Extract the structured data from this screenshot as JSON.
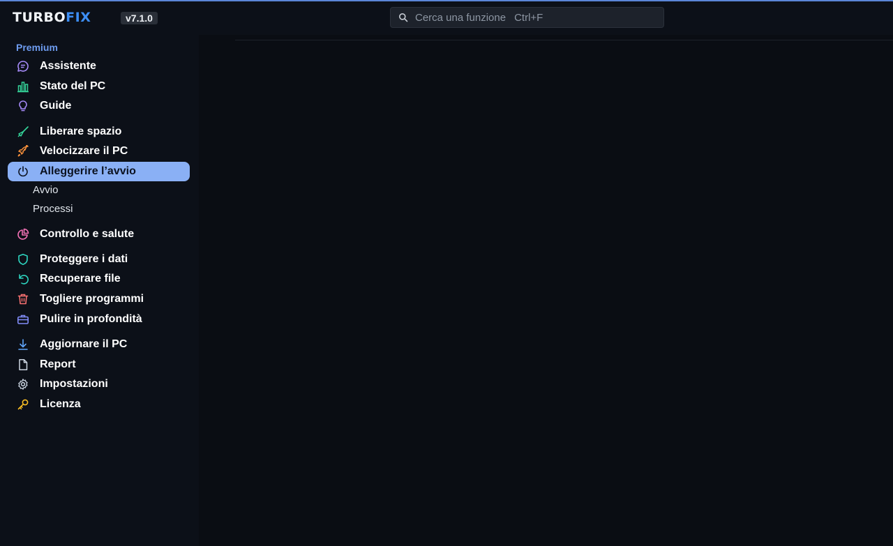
{
  "app": {
    "logo_part1": "TURBO",
    "logo_part2": "FIX",
    "version": "v7.1.0"
  },
  "search": {
    "placeholder": "Cerca una funzione",
    "shortcut": "Ctrl+F"
  },
  "sidebar": {
    "section_label": "Premium",
    "items": [
      {
        "label": "Assistente",
        "icon": "chat-icon",
        "color": "#a78bfa"
      },
      {
        "label": "Stato del PC",
        "icon": "bar-chart-icon",
        "color": "#34d399"
      },
      {
        "label": "Guide",
        "icon": "lightbulb-icon",
        "color": "#a78bfa"
      },
      {
        "label": "Liberare spazio",
        "icon": "broom-icon",
        "color": "#34d399"
      },
      {
        "label": "Velocizzare il PC",
        "icon": "rocket-icon",
        "color": "#fb923c"
      },
      {
        "label": "Alleggerire l’avvio",
        "icon": "power-icon",
        "color": "#0b1220",
        "active": true
      },
      {
        "label": "Controllo e salute",
        "icon": "pie-chart-icon",
        "color": "#f472b6"
      },
      {
        "label": "Proteggere i dati",
        "icon": "shield-icon",
        "color": "#2dd4bf"
      },
      {
        "label": "Recuperare file",
        "icon": "undo-icon",
        "color": "#2dd4bf"
      },
      {
        "label": "Togliere programmi",
        "icon": "trash-icon",
        "color": "#f87171"
      },
      {
        "label": "Pulire in profondità",
        "icon": "toolbox-icon",
        "color": "#818cf8"
      },
      {
        "label": "Aggiornare il PC",
        "icon": "download-icon",
        "color": "#60a5fa"
      },
      {
        "label": "Report",
        "icon": "file-icon",
        "color": "#cbd5e1"
      },
      {
        "label": "Impostazioni",
        "icon": "gear-icon",
        "color": "#cbd5e1"
      },
      {
        "label": "Licenza",
        "icon": "key-icon",
        "color": "#fbbf24"
      }
    ],
    "subitems": [
      "Avvio",
      "Processi"
    ]
  },
  "colors": {
    "accent": "#8ab0f5",
    "background": "#0a0d13",
    "sidebar": "#0c1018"
  }
}
